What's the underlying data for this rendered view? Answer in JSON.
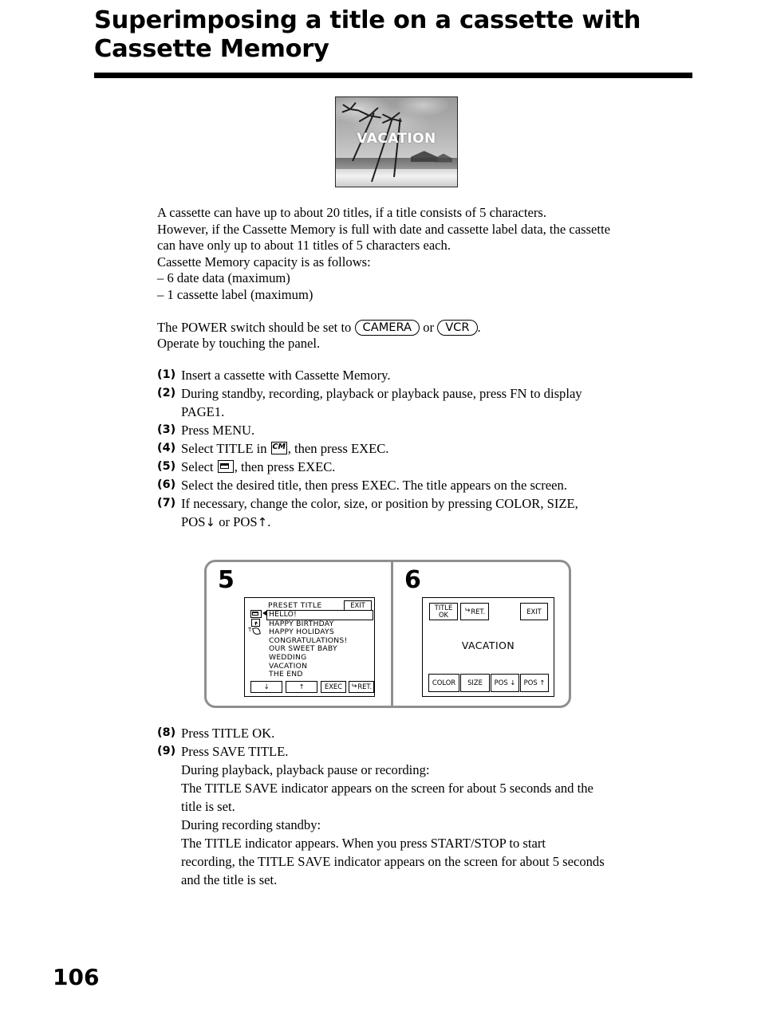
{
  "header": {
    "title": "Superimposing a title on a cassette with Cassette Memory"
  },
  "photo": {
    "caption": "VACATION",
    "alt_name": "beach-palm-tree-photo"
  },
  "intro": {
    "line1": "A cassette can have up to about 20 titles, if a title consists of 5 characters.",
    "line2": "However, if the Cassette Memory is full with date and cassette label data, the cassette",
    "line3": "can have only up to about 11 titles of 5 characters each.",
    "line4": "Cassette Memory capacity is as follows:",
    "line5": "– 6 date data (maximum)",
    "line6": "– 1 cassette label (maximum)",
    "power_prefix": "The POWER switch should be set to",
    "power_camera": "CAMERA",
    "power_or": "or",
    "power_vcr": "VCR",
    "power_suffix": ".",
    "operate": "Operate by touching the panel."
  },
  "steps": [
    {
      "num": "(1)",
      "text": "Insert a cassette with Cassette Memory."
    },
    {
      "num": "(2)",
      "text": "During standby, recording, playback or playback pause, press FN to display",
      "cont": "PAGE1."
    },
    {
      "num": "(3)",
      "text": "Press MENU."
    },
    {
      "num": "(4)",
      "pre": "Select TITLE in",
      "icon": "cassette-memory-icon",
      "post": ", then press EXEC."
    },
    {
      "num": "(5)",
      "pre": "Select",
      "icon": "folder-icon",
      "post": ", then press EXEC."
    },
    {
      "num": "(6)",
      "text": "Select the desired title, then press EXEC. The title appears on the screen."
    },
    {
      "num": "(7)",
      "text": "If necessary, change the color, size, or position by pressing COLOR, SIZE,",
      "cont_pre": "POS",
      "cont_arrow_down": "↓",
      "cont_mid": "or POS",
      "cont_arrow_up": "↑",
      "cont_post": "."
    }
  ],
  "diagram": {
    "panel5": {
      "number": "5",
      "heading": "PRESET  TITLE",
      "exit": "EXIT",
      "titles": [
        "HELLO!",
        "HAPPY  BIRTHDAY",
        "HAPPY  HOLIDAYS",
        "CONGRATULATIONS!",
        "OUR  SWEET BABY",
        "WEDDING",
        "VACATION",
        "THE  END"
      ],
      "selected_index": 0,
      "side_icons": [
        "folder-icon",
        "archive-icon",
        "pencil-icon"
      ],
      "buttons": {
        "down": "↓",
        "up": "↑",
        "exec": "EXEC",
        "ret": "RET."
      }
    },
    "panel6": {
      "number": "6",
      "title_ok_line1": "TITLE",
      "title_ok_line2": "OK",
      "ret": "RET.",
      "exit": "EXIT",
      "osd_title": "VACATION",
      "buttons": {
        "color": "COLOR",
        "size": "SIZE",
        "pos_down": "POS ↓",
        "pos_up": "POS ↑"
      }
    }
  },
  "steps_after": [
    {
      "num": "(8)",
      "text": "Press TITLE OK."
    },
    {
      "num": "(9)",
      "text": "Press SAVE TITLE.",
      "lines": [
        "During playback, playback pause or recording:",
        "The TITLE SAVE indicator appears on the screen for about 5 seconds and the",
        "title is set.",
        "During recording standby:",
        "The TITLE indicator appears. When you press START/STOP to start",
        "recording, the TITLE SAVE indicator appears on the screen for about 5 seconds",
        "and the title is set."
      ]
    }
  ],
  "footer": {
    "page_number": "106"
  },
  "colors": {
    "text": "#000000",
    "page_bg": "#ffffff",
    "diagram_frame": "#8f8f8f",
    "rule": "#000000"
  }
}
